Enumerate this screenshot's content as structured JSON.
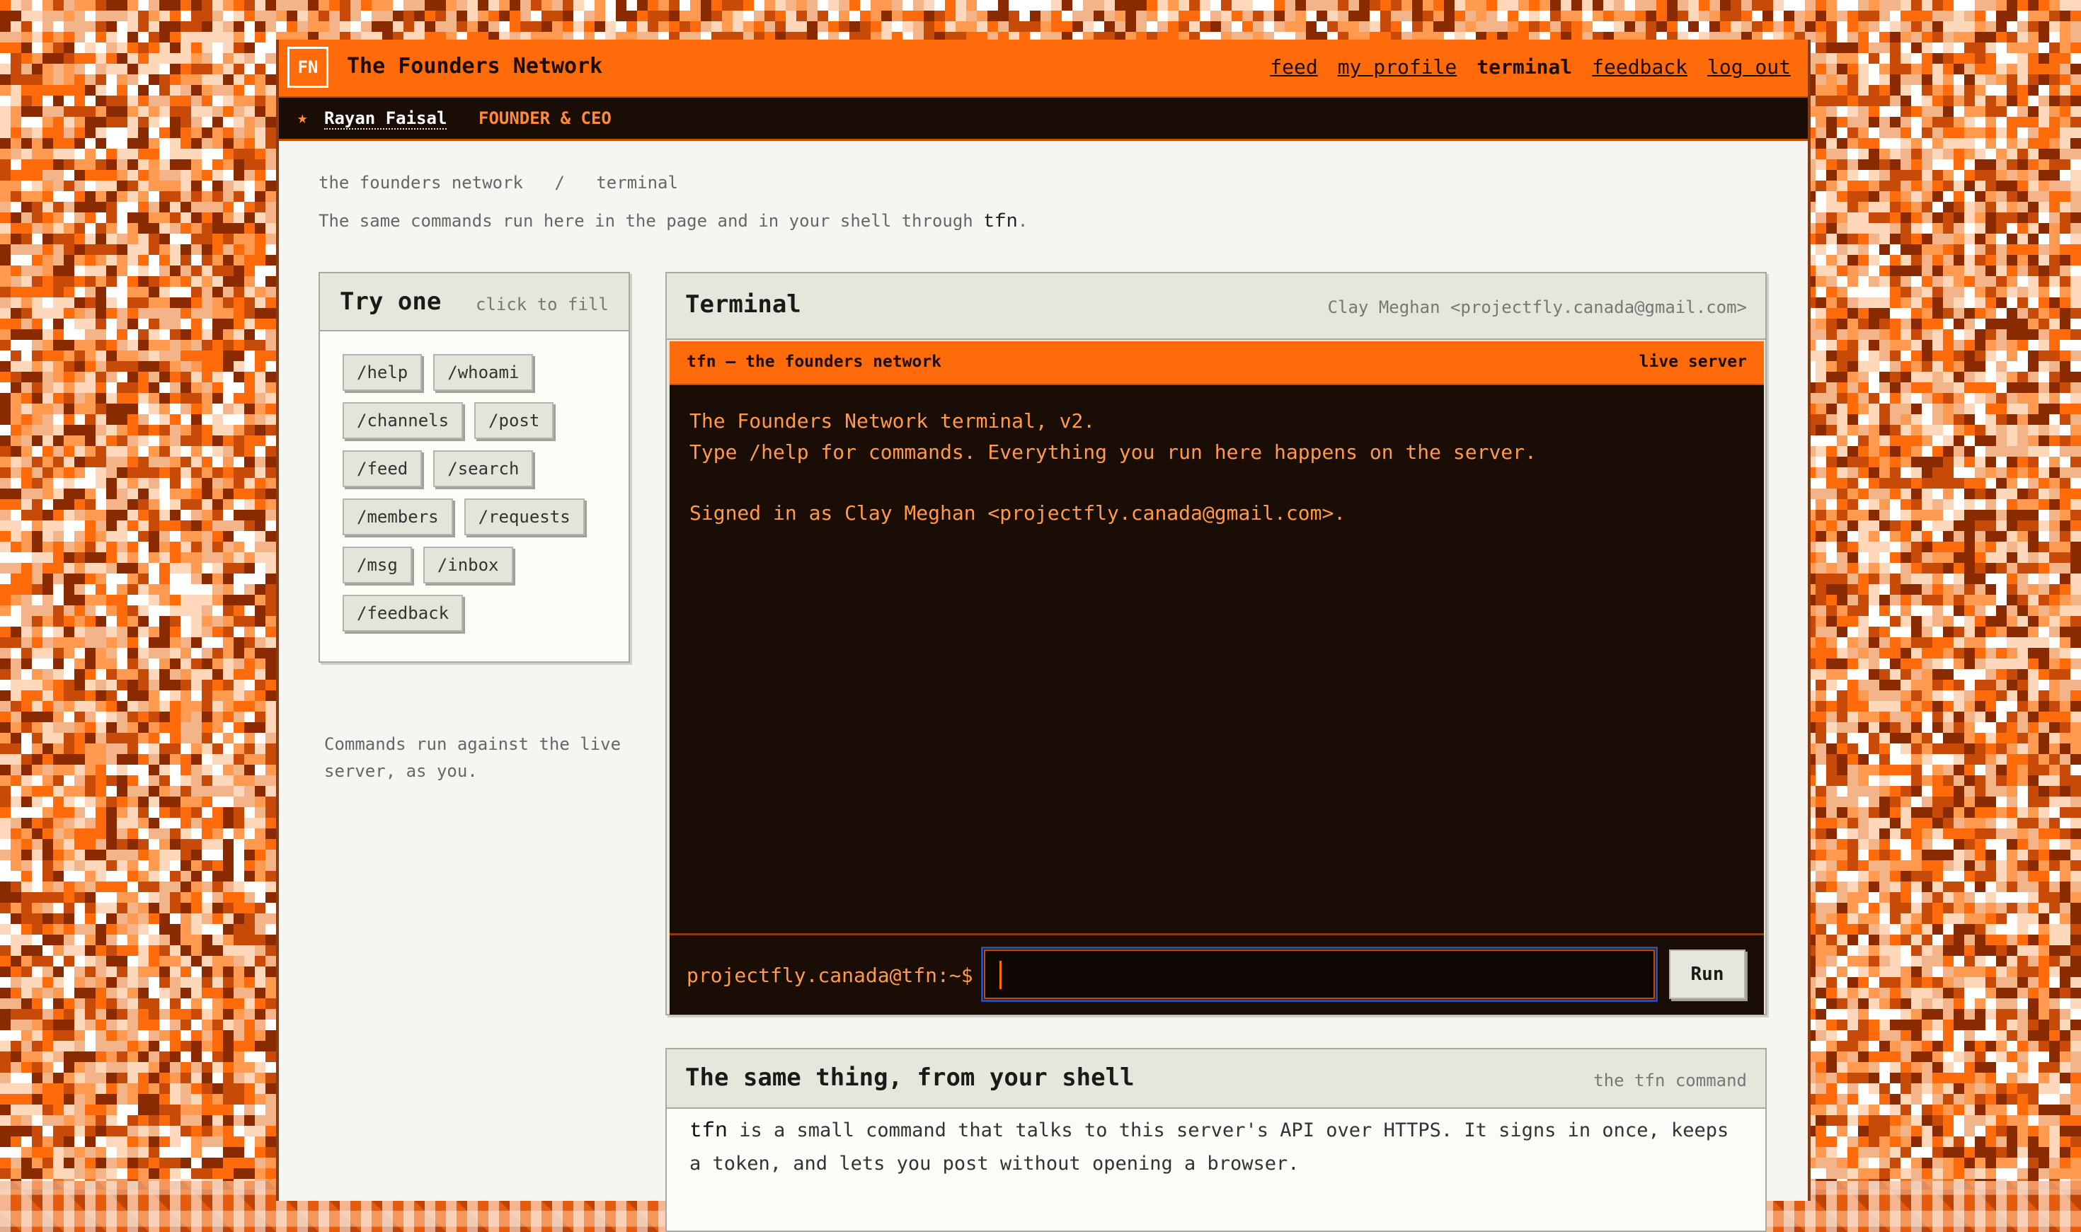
{
  "header": {
    "logo": "FN",
    "brand": "The Founders Network",
    "nav": [
      {
        "label": "feed",
        "active": false
      },
      {
        "label": "my profile",
        "active": false
      },
      {
        "label": "terminal",
        "active": true
      },
      {
        "label": "feedback",
        "active": false
      },
      {
        "label": "log out",
        "active": false
      }
    ]
  },
  "userbar": {
    "star": "★",
    "name": "Rayan Faisal",
    "role": "FOUNDER & CEO"
  },
  "breadcrumb": {
    "root": "the founders network",
    "sep": "/",
    "current": "terminal"
  },
  "intro": {
    "text": "The same commands run here in the page and in your shell through",
    "code": "tfn",
    "end": "."
  },
  "try_one": {
    "title": "Try one",
    "subtitle": "click to fill",
    "commands": [
      "/help",
      "/whoami",
      "/channels",
      "/post",
      "/feed",
      "/search",
      "/members",
      "/requests",
      "/msg",
      "/inbox",
      "/feedback"
    ],
    "note": "Commands run against the live server, as you."
  },
  "terminal": {
    "title": "Terminal",
    "user": "Clay Meghan <projectfly.canada@gmail.com>",
    "bar_left": "tfn — the founders network",
    "bar_right": "live server",
    "lines": [
      "The Founders Network terminal, v2.",
      "Type /help for commands. Everything you run here happens on the server.",
      "Signed in as Clay Meghan <projectfly.canada@gmail.com>."
    ],
    "prompt": "projectfly.canada@tfn:~$",
    "input_value": "",
    "run_label": "Run"
  },
  "shell": {
    "title": "The same thing, from your shell",
    "subtitle": "the tfn command",
    "code": "tfn",
    "text": " is a small command that talks to this server's API over HTTPS. It signs in once, keeps a token, and lets you post without opening a browser."
  },
  "colors": {
    "accent": "#ff6a0a",
    "dark": "#1a0d05",
    "terminal_text": "#ff9a4a",
    "panel": "#e6e6dc"
  }
}
